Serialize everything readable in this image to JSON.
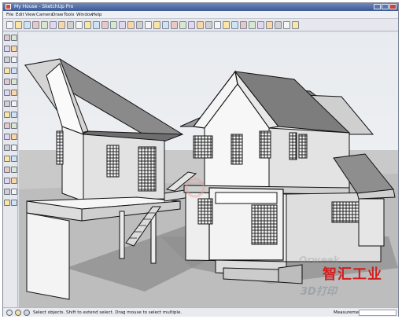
{
  "window": {
    "title": "My House - SketchUp Pro"
  },
  "menu": [
    "File",
    "Edit",
    "View",
    "Camera",
    "Draw",
    "Tools",
    "Window",
    "Help"
  ],
  "toolbar_icons": [
    "new-icon",
    "open-icon",
    "save-icon",
    "cut-icon",
    "copy-icon",
    "paste-icon",
    "erase-icon",
    "undo-icon",
    "redo-icon",
    "print-icon",
    "user-icon",
    "model-info-icon",
    "globe-icon",
    "iso-view-icon",
    "top-view-icon",
    "front-view-icon",
    "right-view-icon",
    "back-view-icon",
    "left-view-icon",
    "xray-icon",
    "wireframe-icon",
    "hidden-line-icon",
    "shaded-icon",
    "textured-icon",
    "monochrome-icon",
    "section-plane-icon",
    "section-cut-icon",
    "components-icon",
    "materials-icon",
    "styles-icon",
    "layers-icon",
    "shadows-icon",
    "fog-icon",
    "sandbox-icon"
  ],
  "left_tools": [
    "select-icon",
    "component-icon",
    "paint-icon",
    "eraser-icon",
    "line-icon",
    "arc-icon",
    "rectangle-icon",
    "circle-icon",
    "polygon-icon",
    "freehand-icon",
    "move-icon",
    "pushpull-icon",
    "rotate-icon",
    "followme-icon",
    "scale-icon",
    "offset-icon",
    "tape-icon",
    "dimension-icon",
    "protractor-icon",
    "text-icon",
    "axes-icon",
    "3dtext-icon",
    "orbit-icon",
    "pan-icon",
    "zoom-icon",
    "zoom-window-icon",
    "zoom-extents-icon",
    "previous-icon",
    "position-camera-icon",
    "walk-icon",
    "lookaround-icon",
    "section-icon"
  ],
  "status": {
    "text": "Select objects. Shift to extend select. Drag mouse to select multiple.",
    "measurements_label": "Measurements"
  },
  "watermark": {
    "site": "Orweek",
    "main": "智汇工业",
    "sub": "3D打印"
  },
  "colors": {
    "title_bar": "#3c5a96",
    "chrome": "#e6e8ee",
    "watermark_red": "#d21e1e"
  }
}
